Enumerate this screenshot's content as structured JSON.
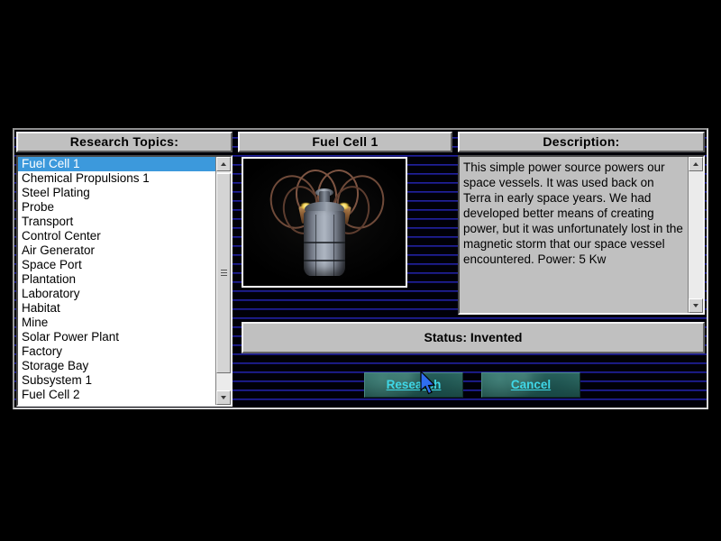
{
  "window": {
    "background_line_color": "#21219c",
    "background_color": "#000008",
    "panel_face_color": "#c0c0c0"
  },
  "topics_panel": {
    "header_label": "Research Topics:",
    "selected_index": 0,
    "items": [
      "Fuel Cell 1",
      "Chemical Propulsions 1",
      "Steel Plating",
      "Probe",
      "Transport",
      "Control Center",
      "Air Generator",
      "Space Port",
      "Plantation",
      "Laboratory",
      "Habitat",
      "Mine",
      "Solar Power Plant",
      "Factory",
      "Storage Bay",
      "Subsystem 1",
      "Fuel Cell 2"
    ],
    "scrollbar": {
      "up_arrow": "scroll-up-arrow",
      "down_arrow": "scroll-down-arrow",
      "thumb_grip": "grip-lines"
    }
  },
  "preview_panel": {
    "title": "Fuel Cell 1",
    "image_alt": "fuel-cell-3d-render"
  },
  "description_panel": {
    "header_label": "Description:",
    "body": "This simple power source powers our space vessels.  It was used back on Terra in early space years. We had developed better means of creating power, but it was unfortunately lost in the magnetic storm that our space vessel encountered.  Power: 5 Kw",
    "scrollbar": {
      "up_arrow": "scroll-up-arrow",
      "down_arrow": "scroll-down-arrow"
    }
  },
  "status": {
    "text": "Status: Invented"
  },
  "buttons": {
    "research": {
      "accel": "R",
      "rest": "esearch",
      "full_label": "Research",
      "text_color": "#3fd8e8"
    },
    "cancel": {
      "accel": "C",
      "rest": "ancel",
      "full_label": "Cancel",
      "text_color": "#3fd8e8"
    }
  },
  "cursor": {
    "name": "mouse-pointer",
    "color": "#2f6ef0"
  }
}
